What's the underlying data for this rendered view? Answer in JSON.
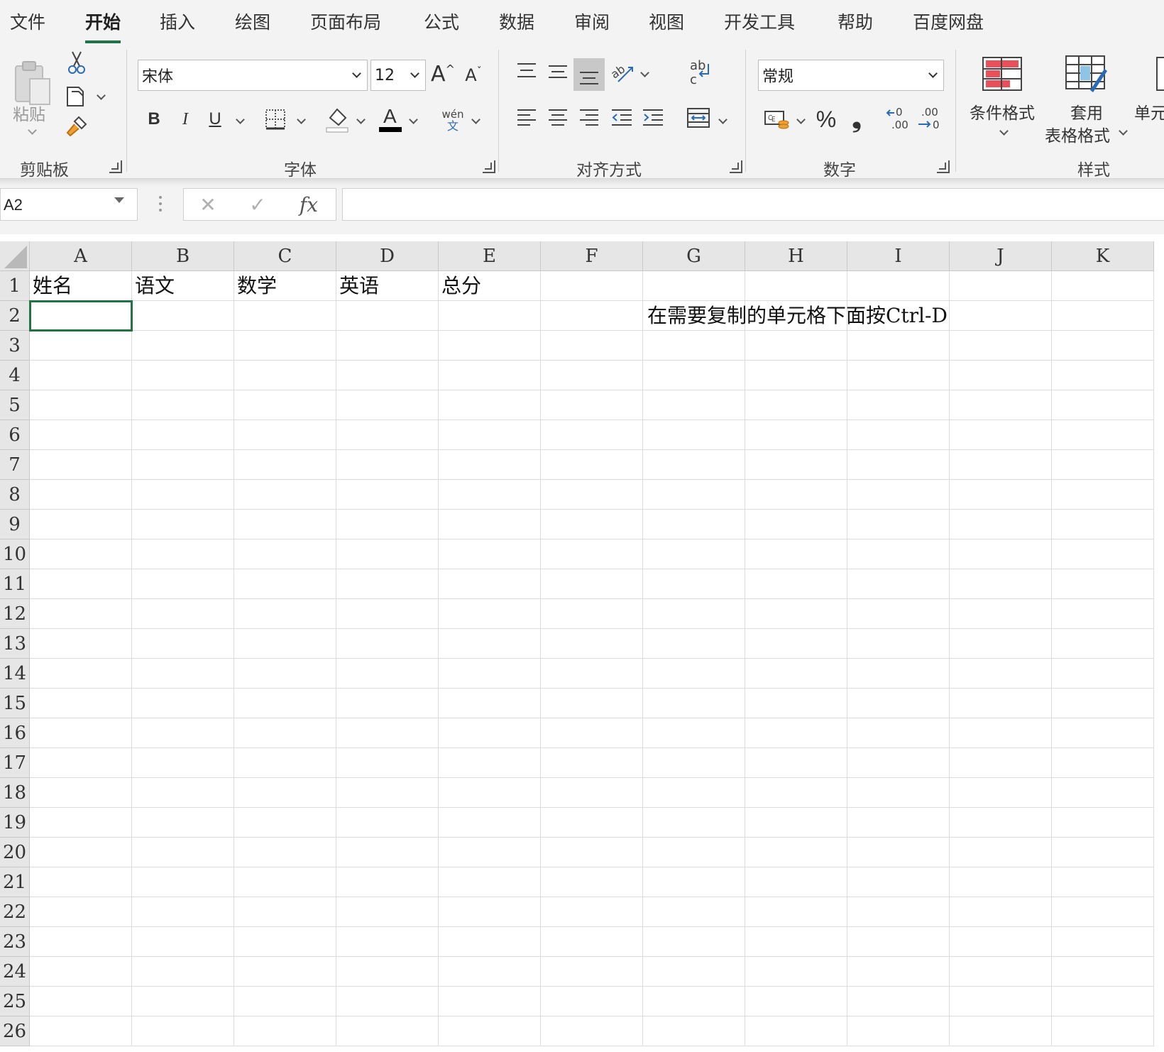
{
  "tabs": [
    "文件",
    "开始",
    "插入",
    "绘图",
    "页面布局",
    "公式",
    "数据",
    "审阅",
    "视图",
    "开发工具",
    "帮助",
    "百度网盘"
  ],
  "ribbon": {
    "clipboard": {
      "paste": "粘贴",
      "label": "剪贴板"
    },
    "font": {
      "name": "宋体",
      "size": "12",
      "label": "字体",
      "bold": "B",
      "italic": "I",
      "underline": "U",
      "phonetic_top": "wén",
      "phonetic_bottom": "文"
    },
    "alignment": {
      "label": "对齐方式"
    },
    "number": {
      "format": "常规",
      "label": "数字",
      "percent": "%",
      "comma": "❟",
      "inc_decimal": ".00",
      "dec_decimal": ".00"
    },
    "styles": {
      "conditional": "条件格式",
      "table_format_1": "套用",
      "table_format_2": "表格格式",
      "cell_styles": "单元",
      "label": "样式"
    }
  },
  "formula_bar": {
    "name_box": "A2",
    "cancel": "✕",
    "enter": "✓",
    "fx": "fx",
    "value": ""
  },
  "sheet": {
    "columns": [
      "A",
      "B",
      "C",
      "D",
      "E",
      "F",
      "G",
      "H",
      "I",
      "J",
      "K"
    ],
    "rows": [
      "1",
      "2",
      "3",
      "4",
      "5",
      "6",
      "7",
      "8",
      "9",
      "10",
      "11",
      "12",
      "13",
      "14",
      "15",
      "16",
      "17",
      "18",
      "19",
      "20",
      "21",
      "22",
      "23",
      "24",
      "25",
      "26"
    ],
    "row1": [
      "姓名",
      "语文",
      "数学",
      "英语",
      "总分"
    ],
    "note": "在需要复制的单元格下面按Ctrl-D",
    "selected_cell": "A2"
  },
  "colors": {
    "accent": "#217346",
    "ribbon_bg": "#f3f3f3",
    "header_bg": "#e6e6e6",
    "font_red": "#000000"
  }
}
